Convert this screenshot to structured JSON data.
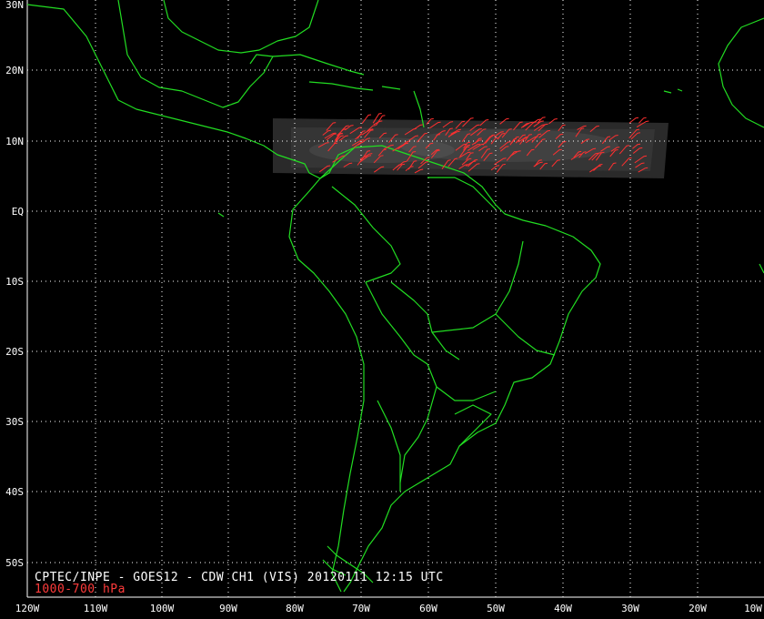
{
  "map": {
    "lat_labels": [
      "30N",
      "20N",
      "10N",
      "EQ",
      "10S",
      "20S",
      "30S",
      "40S",
      "50S"
    ],
    "lon_labels": [
      "120W",
      "110W",
      "100W",
      "90W",
      "80W",
      "70W",
      "60W",
      "50W",
      "40W",
      "30W",
      "20W",
      "10W"
    ],
    "caption": "CPTEC/INPE - GOES12 - CDW CH1 (VIS) 20120111 12:15 UTC",
    "layer_label": "1000-700 hPa",
    "colors": {
      "background": "#000000",
      "coastline": "#22dd22",
      "grid": "#ffffff",
      "wind_vectors": "#ff3030",
      "caption": "#ffffff",
      "layer_label": "#ff3b3b"
    },
    "grid_style": "dotted",
    "icons": [
      "wind-barb-icon"
    ]
  }
}
